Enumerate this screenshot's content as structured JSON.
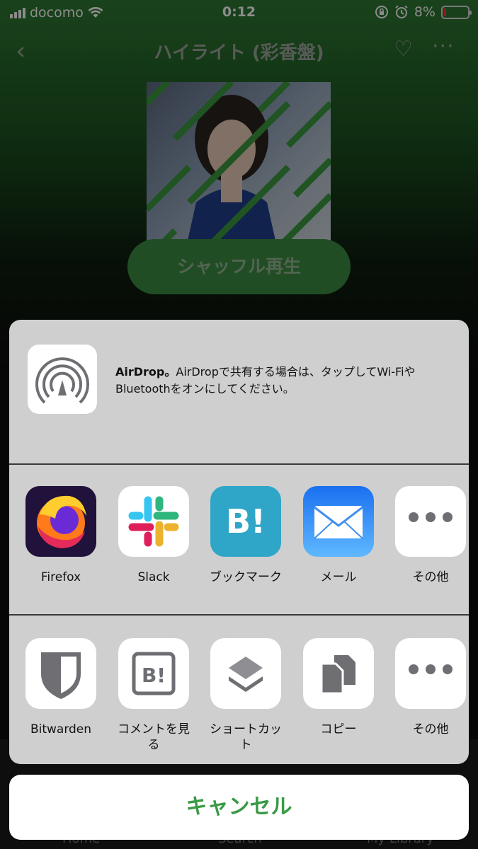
{
  "status_bar": {
    "carrier": "docomo",
    "time": "0:12",
    "battery_percent": "8%",
    "battery_level": 0.08
  },
  "nav": {
    "title": "ハイライト (彩香盤)",
    "back_icon": "chevron-left",
    "favorite_icon": "heart",
    "more_icon": "ellipsis"
  },
  "player": {
    "shuffle_label": "シャッフル再生"
  },
  "share_sheet": {
    "airdrop_title": "AirDrop。",
    "airdrop_message": "AirDropで共有する場合は、タップしてWi-Fiや Bluetoothをオンにしてください。",
    "apps": [
      {
        "label": "Firefox",
        "icon": "firefox-icon"
      },
      {
        "label": "Slack",
        "icon": "slack-icon"
      },
      {
        "label": "ブックマーク",
        "icon": "hatena-bookmark-icon"
      },
      {
        "label": "メール",
        "icon": "mail-icon"
      },
      {
        "label": "その他",
        "icon": "more-icon"
      }
    ],
    "actions": [
      {
        "label": "Bitwarden",
        "icon": "bitwarden-icon"
      },
      {
        "label": "コメントを見る",
        "icon": "hatena-comment-icon"
      },
      {
        "label": "ショートカット",
        "icon": "shortcuts-icon"
      },
      {
        "label": "コピー",
        "icon": "copy-icon"
      },
      {
        "label": "その他",
        "icon": "more-icon"
      }
    ],
    "cancel_label": "キャンセル"
  },
  "tab_bar": {
    "items": [
      "Home",
      "Search",
      "My Library"
    ]
  },
  "colors": {
    "accent_green": "#3a9a44",
    "mail_blue": "#2f8cf5",
    "hatena_blue": "#2fa6c8",
    "firefox_bg": "#20123a"
  }
}
